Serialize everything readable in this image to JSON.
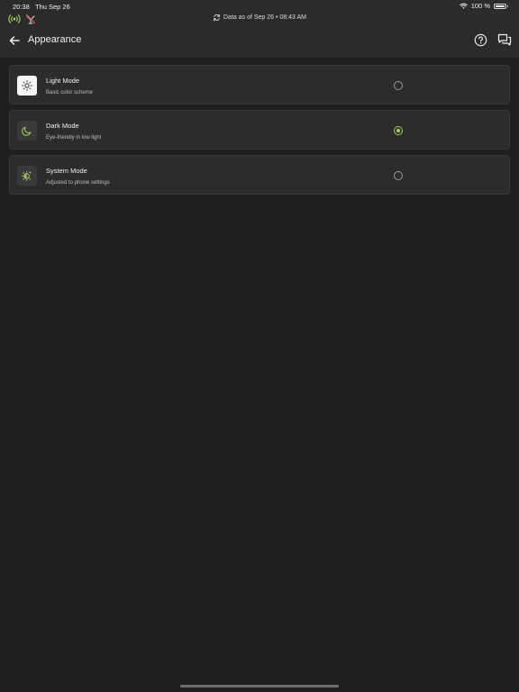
{
  "status_bar": {
    "time": "20:38",
    "date": "Thu Sep 26",
    "battery_text": "100 %",
    "battery_level": 1.0,
    "icons": [
      "wifi-icon",
      "battery-icon"
    ]
  },
  "sync": {
    "text": "Data as of Sep 26 • 08:43 AM",
    "icon": "refresh-icon"
  },
  "header": {
    "title": "Appearance",
    "back_icon": "arrow-left-icon",
    "help_icon": "question-circle-icon",
    "chat_icon": "chat-bubbles-icon"
  },
  "colors": {
    "accent": "#a8d060",
    "background": "#1f1f1f",
    "header_background": "#2b2b2b",
    "card_background": "#2c2c2c"
  },
  "options": [
    {
      "title": "Light Mode",
      "subtitle": "Basic color scheme",
      "icon": "sun-icon",
      "selected": false
    },
    {
      "title": "Dark Mode",
      "subtitle": "Eye-friendly in low light",
      "icon": "moon-icon",
      "selected": true
    },
    {
      "title": "System Mode",
      "subtitle": "Adjusted to phone settings",
      "icon": "auto-brightness-icon",
      "selected": false
    }
  ]
}
